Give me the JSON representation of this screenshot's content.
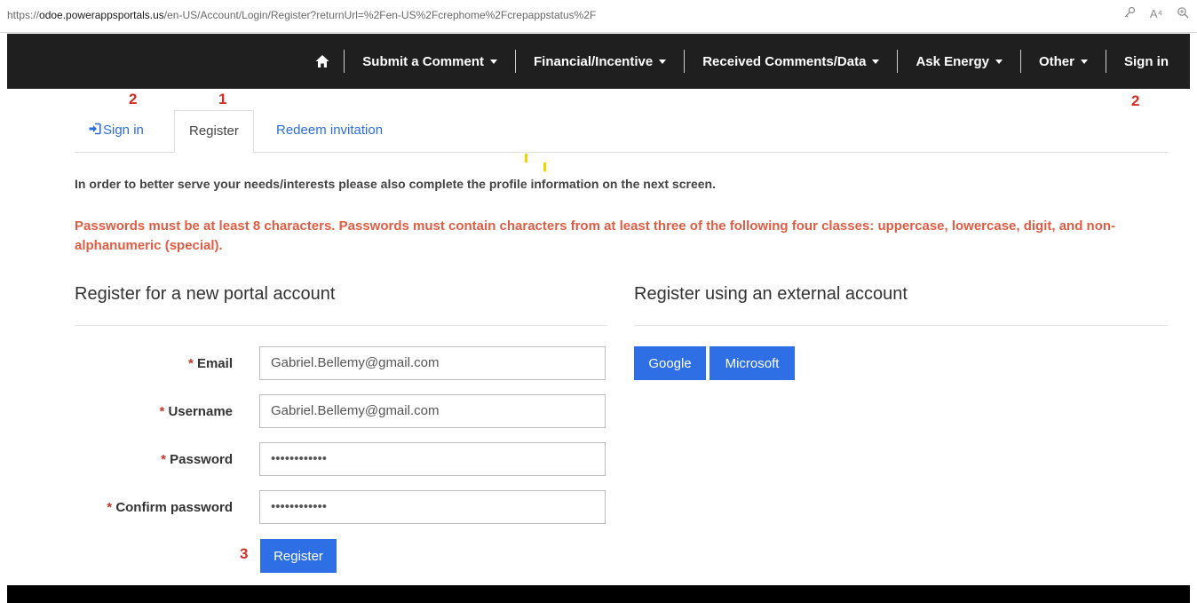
{
  "browser": {
    "url_prefix": "https://",
    "url_domain": "odoe.powerappsportals.us",
    "url_path": "/en-US/Account/Login/Register?returnUrl=%2Fen-US%2Fcrephome%2Fcrepappstatus%2F",
    "tool_icons": [
      "key-icon",
      "read-aloud-icon",
      "zoom-icon"
    ],
    "read_aloud_glyph": "A⁴"
  },
  "navbar": {
    "items": [
      {
        "label": "Submit a Comment",
        "dropdown": true
      },
      {
        "label": "Financial/Incentive",
        "dropdown": true
      },
      {
        "label": "Received Comments/Data",
        "dropdown": true
      },
      {
        "label": "Ask Energy",
        "dropdown": true
      },
      {
        "label": "Other",
        "dropdown": true
      },
      {
        "label": "Sign in",
        "dropdown": false
      }
    ]
  },
  "annotations": {
    "signin_tab": "2",
    "register_tab": "1",
    "nav_signin": "2",
    "register_button": "3"
  },
  "tabs": {
    "signin": "Sign in",
    "register": "Register",
    "redeem": "Redeem invitation",
    "active": "Register"
  },
  "info_text": "In order to better serve your needs/interests please also complete the profile information on the next screen.",
  "password_warning": "Passwords must be at least 8 characters. Passwords must contain characters from at least three of the following four classes: uppercase, lowercase, digit, and non-alphanumeric (special).",
  "register_local": {
    "title": "Register for a new portal account",
    "required_marker": "*",
    "email_label": "Email",
    "email_value": "Gabriel.Bellemy@gmail.com",
    "username_label": "Username",
    "username_value": "Gabriel.Bellemy@gmail.com",
    "password_label": "Password",
    "password_value": "••••••••••••",
    "confirm_label": "Confirm password",
    "confirm_value": "••••••••••••",
    "submit_label": "Register"
  },
  "register_external": {
    "title": "Register using an external account",
    "google_label": "Google",
    "microsoft_label": "Microsoft"
  },
  "colors": {
    "navbar_bg": "#1f1f1f",
    "link": "#2d6cdf",
    "button": "#2e6fe5",
    "warning": "#e05d44",
    "annotation": "#d12d24",
    "highlight_marks": "#f2d300"
  }
}
